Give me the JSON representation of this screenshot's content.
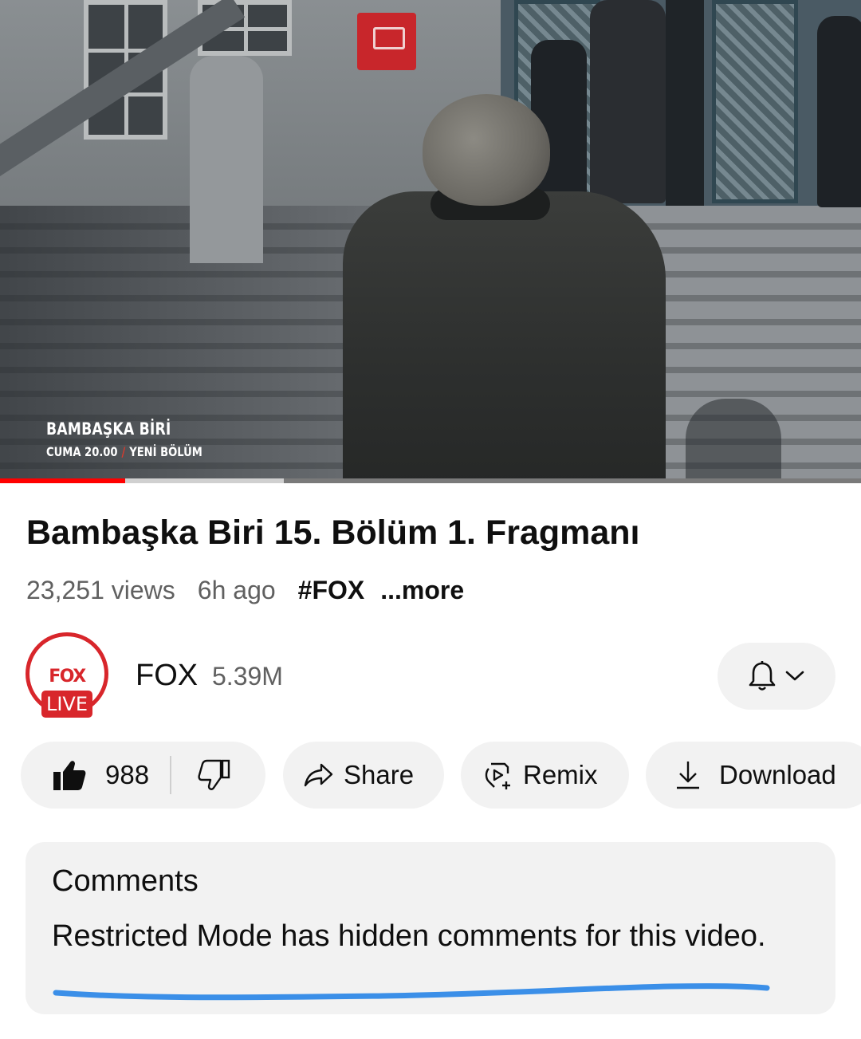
{
  "player": {
    "overlay_title": "BAMBAŞKA BİRİ",
    "overlay_day_time": "CUMA 20.00",
    "overlay_separator": "/",
    "overlay_episode": "YENİ BÖLÜM",
    "progress_played_percent": 14.5,
    "progress_buffered_percent": 33,
    "colors": {
      "played": "#ff0000",
      "buffered": "#d0d0d0",
      "track": "#7a7a7a"
    }
  },
  "video": {
    "title": "Bambaşka Biri 15. Bölüm 1. Fragmanı",
    "views": "23,251 views",
    "age": "6h ago",
    "hashtag": "#FOX",
    "more_label": "...more"
  },
  "channel": {
    "avatar_top_text": "FOX",
    "avatar_badge_text": "LIVE",
    "name": "FOX",
    "subscribers": "5.39M",
    "bell_icon": "bell-icon",
    "dropdown_icon": "chevron-down-icon",
    "brand_color": "#d8262b"
  },
  "actions": {
    "like_count": "988",
    "like_icon": "thumbs-up-filled-icon",
    "dislike_icon": "thumbs-down-icon",
    "share_label": "Share",
    "share_icon": "share-arrow-icon",
    "remix_label": "Remix",
    "remix_icon": "remix-icon",
    "download_label": "Download",
    "download_icon": "download-icon"
  },
  "comments": {
    "heading": "Comments",
    "message": "Restricted Mode has hidden comments for this video.",
    "annotation_color": "#3b8fe8"
  }
}
